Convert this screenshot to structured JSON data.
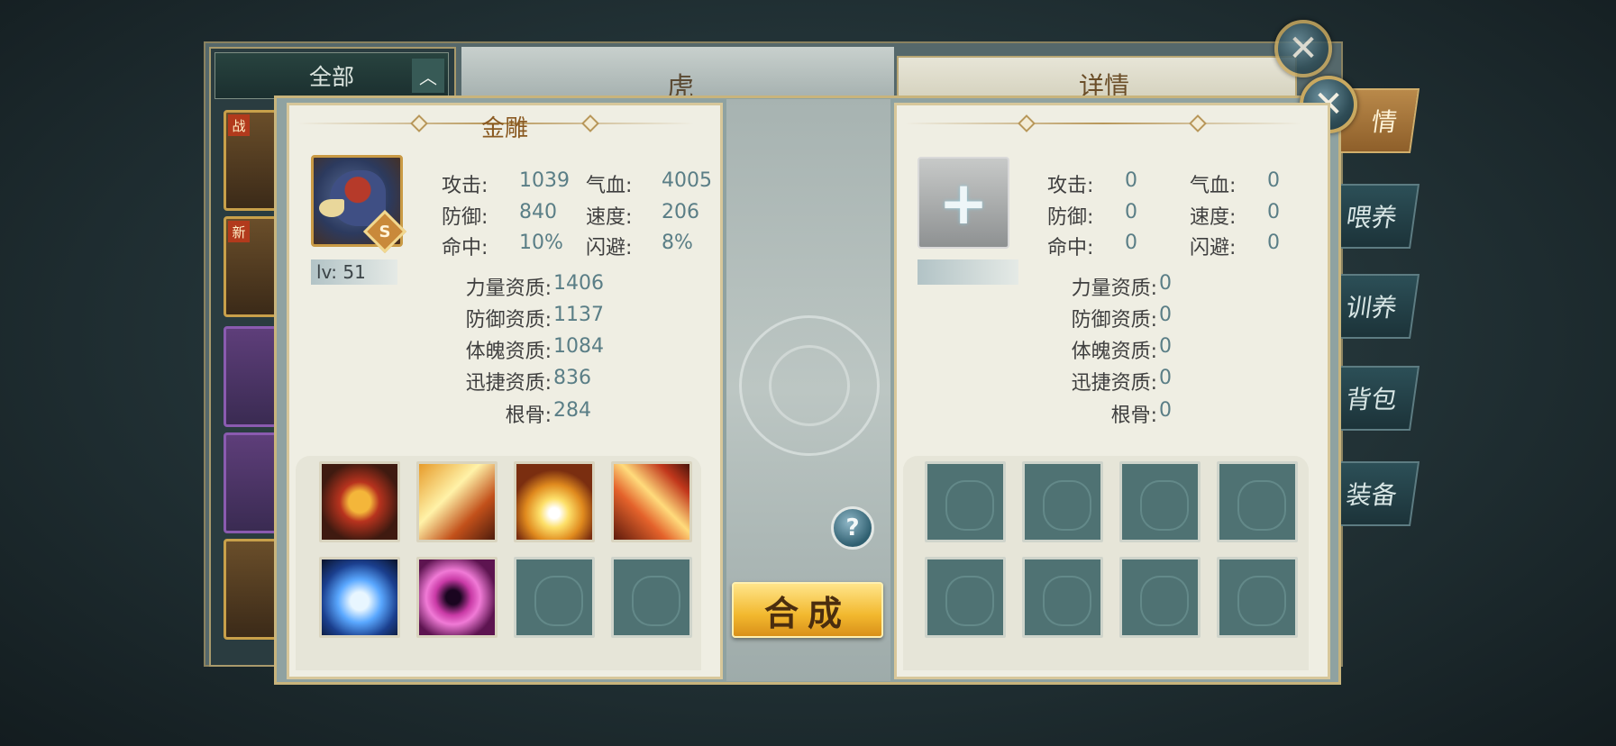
{
  "category_panel": {
    "header": "全部",
    "tags": [
      "战",
      "新"
    ]
  },
  "background_window": {
    "title": "虎",
    "detail_title": "详情"
  },
  "side_tabs": [
    "情",
    "喂养",
    "训养",
    "背包",
    "装备"
  ],
  "left_pet": {
    "name": "金雕",
    "rank": "S",
    "level": "lv: 51",
    "stats": [
      {
        "label": "攻击:",
        "value": "1039"
      },
      {
        "label": "气血:",
        "value": "4005"
      },
      {
        "label": "防御:",
        "value": "840"
      },
      {
        "label": "速度:",
        "value": "206"
      },
      {
        "label": "命中:",
        "value": "10%"
      },
      {
        "label": "闪避:",
        "value": "8%"
      }
    ],
    "aptitudes": [
      {
        "label": "力量资质:",
        "value": "1406"
      },
      {
        "label": "防御资质:",
        "value": "1137"
      },
      {
        "label": "体魄资质:",
        "value": "1084"
      },
      {
        "label": "迅捷资质:",
        "value": "836"
      },
      {
        "label": "根骨:",
        "value": "284"
      }
    ],
    "skills": [
      "fire-orb-skill",
      "flame-slash-skill",
      "golden-burst-skill",
      "fire-claw-skill",
      "water-heart-skill",
      "void-vortex-skill",
      "empty",
      "empty"
    ]
  },
  "right_pet": {
    "add_icon": "+",
    "stats": [
      {
        "label": "攻击:",
        "value": "0"
      },
      {
        "label": "气血:",
        "value": "0"
      },
      {
        "label": "防御:",
        "value": "0"
      },
      {
        "label": "速度:",
        "value": "0"
      },
      {
        "label": "命中:",
        "value": "0"
      },
      {
        "label": "闪避:",
        "value": "0"
      }
    ],
    "aptitudes": [
      {
        "label": "力量资质:",
        "value": "0"
      },
      {
        "label": "防御资质:",
        "value": "0"
      },
      {
        "label": "体魄资质:",
        "value": "0"
      },
      {
        "label": "迅捷资质:",
        "value": "0"
      },
      {
        "label": "根骨:",
        "value": "0"
      }
    ]
  },
  "center": {
    "help_icon": "?",
    "merge_button": "合成"
  },
  "close_icon": "✕",
  "colors": {
    "accent_gold": "#c8b47c",
    "value_blue": "#5a7e86",
    "title_brown": "#8a5a22"
  }
}
